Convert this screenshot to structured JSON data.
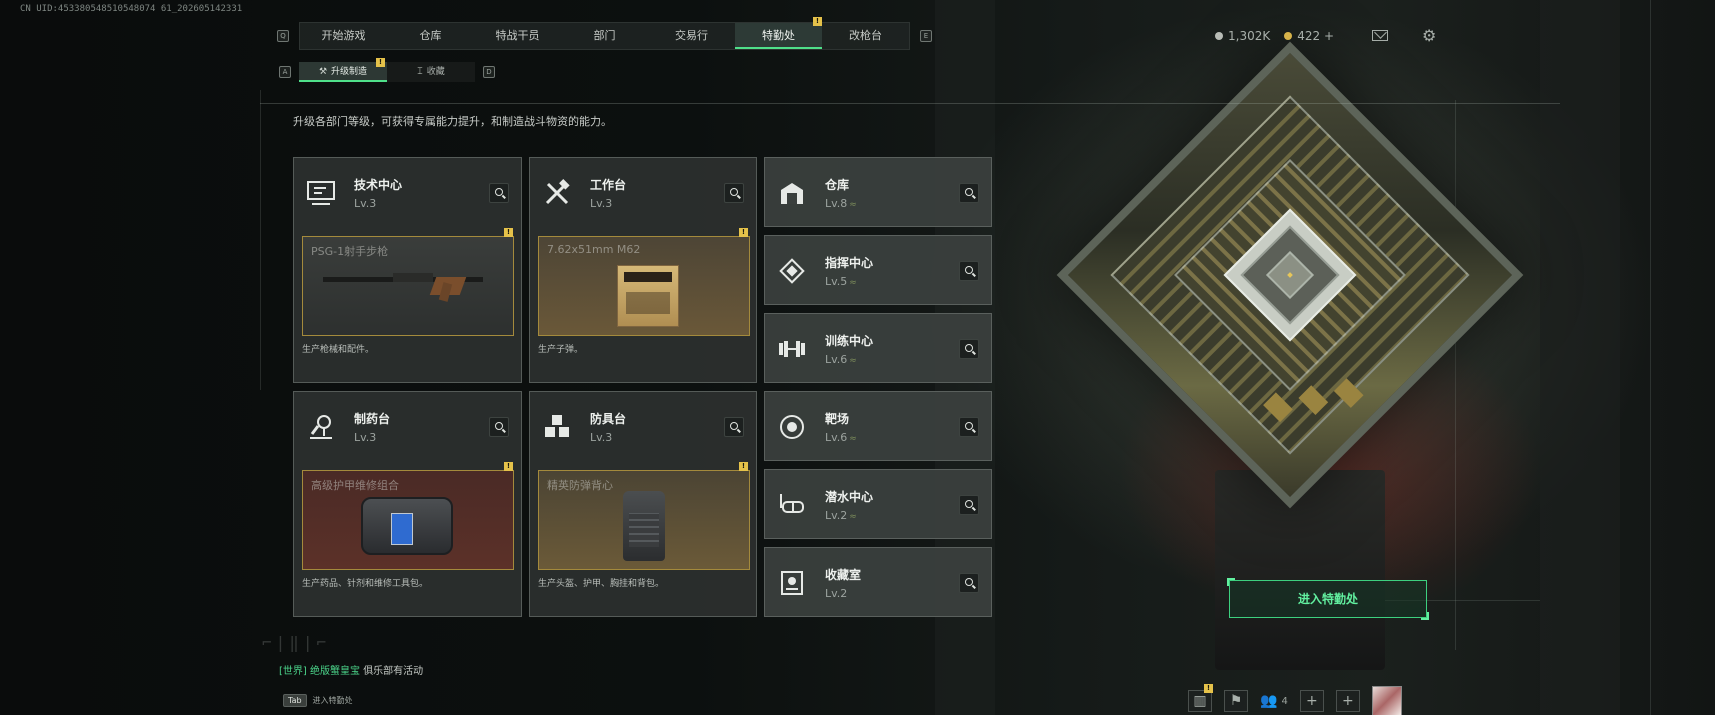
{
  "uid": "CN UID:453380548510548074 61_202605142331",
  "nav": {
    "left_key": "Q",
    "right_key": "E",
    "tabs": [
      {
        "label": "开始游戏"
      },
      {
        "label": "仓库"
      },
      {
        "label": "特战干员"
      },
      {
        "label": "部门"
      },
      {
        "label": "交易行"
      },
      {
        "label": "特勤处",
        "active": true,
        "alert": "!"
      },
      {
        "label": "改枪台"
      }
    ]
  },
  "subnav": {
    "left_key": "A",
    "right_key": "D",
    "tabs": [
      {
        "label": "升级制造",
        "active": true,
        "alert": "!"
      },
      {
        "label": "收藏"
      }
    ]
  },
  "currency": {
    "silver": "1,302K",
    "gold": "422",
    "gold_add": "+"
  },
  "description": "升级各部门等级，可获得专属能力提升，和制造战斗物资的能力。",
  "departments_large": [
    {
      "name": "技术中心",
      "level": "Lv.3",
      "icon": "computer-icon",
      "product": "PSG-1射手步枪",
      "product_alert": "!",
      "note": "生产枪械和配件。"
    },
    {
      "name": "工作台",
      "level": "Lv.3",
      "icon": "tools-icon",
      "product": "7.62x51mm M62",
      "product_alert": "!",
      "note": "生产子弹。"
    },
    {
      "name": "制药台",
      "level": "Lv.3",
      "icon": "microscope-icon",
      "product": "高级护甲维修组合",
      "product_alert": "!",
      "note": "生产药品、针剂和维修工具包。"
    },
    {
      "name": "防具台",
      "level": "Lv.3",
      "icon": "cubes-icon",
      "product": "精英防弹背心",
      "product_alert": "!",
      "note": "生产头盔、护甲、胸挂和背包。"
    }
  ],
  "departments_small": [
    {
      "name": "仓库",
      "level": "Lv.8",
      "icon": "warehouse-icon",
      "upgradable": true
    },
    {
      "name": "指挥中心",
      "level": "Lv.5",
      "icon": "command-icon",
      "upgradable": true
    },
    {
      "name": "训练中心",
      "level": "Lv.6",
      "icon": "dumbbell-icon",
      "upgradable": true
    },
    {
      "name": "靶场",
      "level": "Lv.6",
      "icon": "target-icon",
      "upgradable": true
    },
    {
      "name": "潜水中心",
      "level": "Lv.2",
      "icon": "diving-mask-icon",
      "upgradable": true
    },
    {
      "name": "收藏室",
      "level": "Lv.2",
      "icon": "collection-icon",
      "upgradable": false
    }
  ],
  "enter_button": "进入特勤处",
  "chat": {
    "channel": "[世界]",
    "sender": "绝版蟹皇宝",
    "message": "俱乐部有活动"
  },
  "chat_hint": {
    "key": "Tab",
    "label": "进入特勤处"
  },
  "bottom": {
    "friends_count": "4",
    "stats_alert": "!",
    "add1": "+",
    "add2": "+"
  },
  "colors": {
    "accent": "#4fe08a",
    "alert": "#e5c24a",
    "panel": "#2c302f"
  }
}
